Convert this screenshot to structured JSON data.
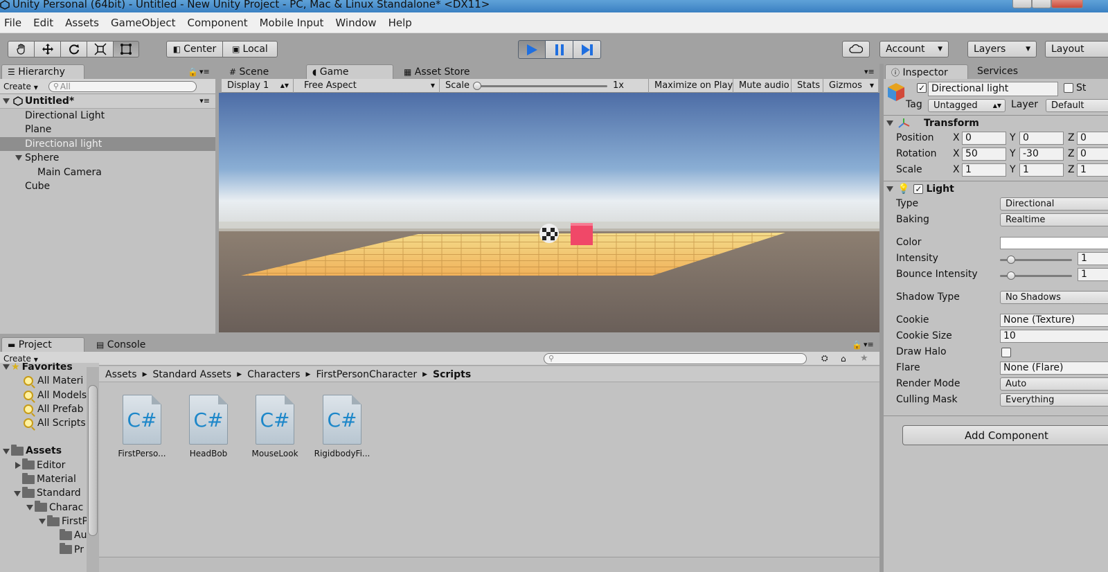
{
  "window": {
    "title": "Unity Personal (64bit) - Untitled - New Unity Project - PC, Mac & Linux Standalone* <DX11>"
  },
  "menu": [
    "File",
    "Edit",
    "Assets",
    "GameObject",
    "Component",
    "Mobile Input",
    "Window",
    "Help"
  ],
  "toolbar": {
    "pivot_label": "Center",
    "space_label": "Local",
    "account_label": "Account",
    "layers_label": "Layers",
    "layout_label": "Layout"
  },
  "hierarchy": {
    "tab": "Hierarchy",
    "create_label": "Create",
    "search_placeholder": "All",
    "scene_name": "Untitled*",
    "items": [
      {
        "label": "Directional Light"
      },
      {
        "label": "Plane"
      },
      {
        "label": "Directional light"
      },
      {
        "label": "Sphere"
      },
      {
        "label": "Main Camera"
      },
      {
        "label": "Cube"
      }
    ]
  },
  "view_tabs": {
    "scene": "Scene",
    "game": "Game",
    "asset_store": "Asset Store"
  },
  "game_bar": {
    "display": "Display 1",
    "aspect": "Free Aspect",
    "scale_label": "Scale",
    "scale_value": "1x",
    "maximize": "Maximize on Play",
    "mute": "Mute audio",
    "stats": "Stats",
    "gizmos": "Gizmos"
  },
  "project": {
    "tab_project": "Project",
    "tab_console": "Console",
    "create_label": "Create",
    "favorites_label": "Favorites",
    "favorites": [
      "All Materi",
      "All Models",
      "All Prefab",
      "All Scripts"
    ],
    "assets_label": "Assets",
    "folders": [
      {
        "label": "Editor"
      },
      {
        "label": "Material"
      },
      {
        "label": "Standard"
      },
      {
        "label": "Charac"
      },
      {
        "label": "FirstP"
      },
      {
        "label": "Au"
      },
      {
        "label": "Pr"
      }
    ],
    "breadcrumb": [
      "Assets",
      "Standard Assets",
      "Characters",
      "FirstPersonCharacter",
      "Scripts"
    ],
    "files": [
      {
        "label": "FirstPerso..."
      },
      {
        "label": "HeadBob"
      },
      {
        "label": "MouseLook"
      },
      {
        "label": "RigidbodyFi..."
      }
    ],
    "file_icon_text": "C#"
  },
  "inspector": {
    "tab_inspector": "Inspector",
    "tab_services": "Services",
    "object_name": "Directional light",
    "static_label": "St",
    "tag_label": "Tag",
    "tag_value": "Untagged",
    "layer_label": "Layer",
    "layer_value": "Default",
    "transform": {
      "title": "Transform",
      "position_label": "Position",
      "rotation_label": "Rotation",
      "scale_label": "Scale",
      "axis_x": "X",
      "axis_y": "Y",
      "axis_z": "Z",
      "position": {
        "x": "0",
        "y": "0",
        "z": "0"
      },
      "rotation": {
        "x": "50",
        "y": "-30",
        "z": "0"
      },
      "scale": {
        "x": "1",
        "y": "1",
        "z": "1"
      }
    },
    "light": {
      "title": "Light",
      "type_label": "Type",
      "type_value": "Directional",
      "baking_label": "Baking",
      "baking_value": "Realtime",
      "color_label": "Color",
      "color_value": "#ffffff",
      "intensity_label": "Intensity",
      "intensity_value": "1",
      "bounce_label": "Bounce Intensity",
      "bounce_value": "1",
      "shadow_label": "Shadow Type",
      "shadow_value": "No Shadows",
      "cookie_label": "Cookie",
      "cookie_value": "None (Texture)",
      "cookie_size_label": "Cookie Size",
      "cookie_size_value": "10",
      "draw_halo_label": "Draw Halo",
      "flare_label": "Flare",
      "flare_value": "None (Flare)",
      "render_mode_label": "Render Mode",
      "render_mode_value": "Auto",
      "culling_label": "Culling Mask",
      "culling_value": "Everything"
    },
    "add_component": "Add Component"
  },
  "colors": {
    "play_accent": "#1f6fe0",
    "panel_bg": "#c2c2c2",
    "selection": "#8e8e8e",
    "cube": "#f04868"
  }
}
